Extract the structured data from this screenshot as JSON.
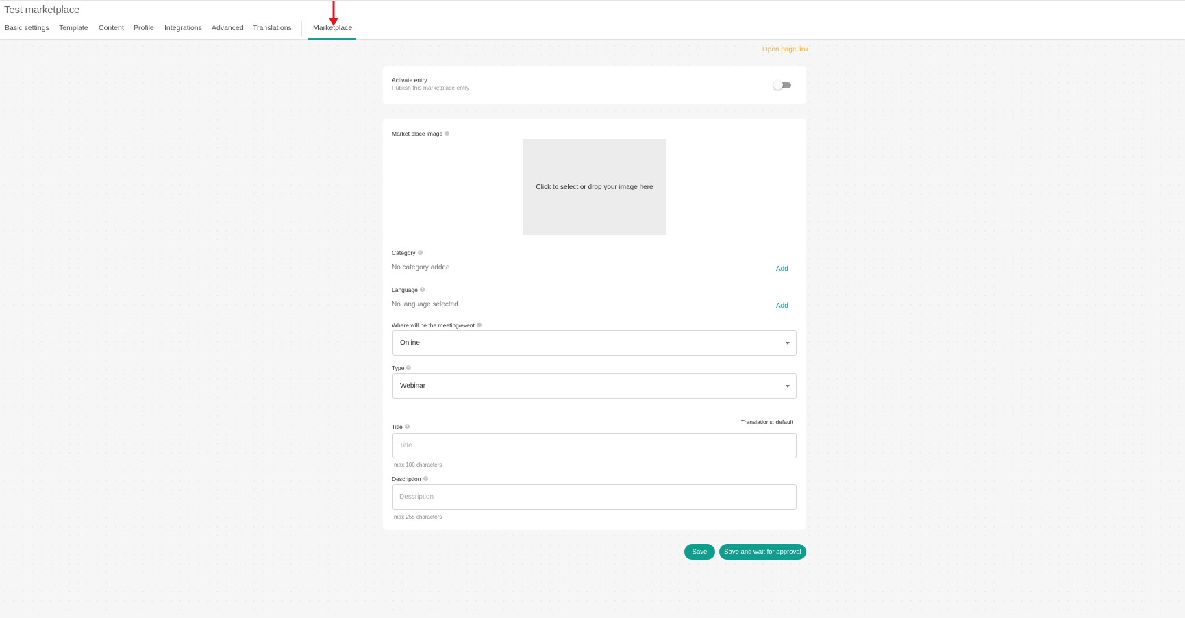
{
  "header": {
    "title": "Test marketplace",
    "tabs": [
      {
        "label": "Basic settings",
        "active": false
      },
      {
        "label": "Template",
        "active": false
      },
      {
        "label": "Content",
        "active": false
      },
      {
        "label": "Profile",
        "active": false
      },
      {
        "label": "Integrations",
        "active": false
      },
      {
        "label": "Advanced",
        "active": false
      },
      {
        "label": "Translations",
        "active": false
      },
      {
        "label": "Marketplace",
        "active": true
      }
    ],
    "annotation_arrow_color": "#e8141b"
  },
  "open_page_link": "Open page link",
  "activate": {
    "title": "Activate entry",
    "subtitle": "Publish this marketplace entry",
    "enabled": false
  },
  "form": {
    "image": {
      "label": "Market place image",
      "dropzone_text": "Click to select or drop your image here"
    },
    "category": {
      "label": "Category",
      "value": "No category added",
      "add_label": "Add"
    },
    "language": {
      "label": "Language",
      "value": "No language selected",
      "add_label": "Add"
    },
    "location": {
      "label": "Where will be the meeting/event",
      "selected": "Online"
    },
    "type": {
      "label": "Type",
      "selected": "Webinar"
    },
    "translations_note": "Translations:  default",
    "title": {
      "label": "Title",
      "value": "",
      "placeholder": "Title",
      "hint": "max 100 characters"
    },
    "description": {
      "label": "Description",
      "value": "",
      "placeholder": "Description",
      "hint": "max 255 characters"
    }
  },
  "actions": {
    "save": "Save",
    "save_approval": "Save and wait for approval"
  },
  "colors": {
    "accent": "#0f9e8e",
    "link_orange": "#f2ae30",
    "tab_underline": "#1a9e8f"
  }
}
